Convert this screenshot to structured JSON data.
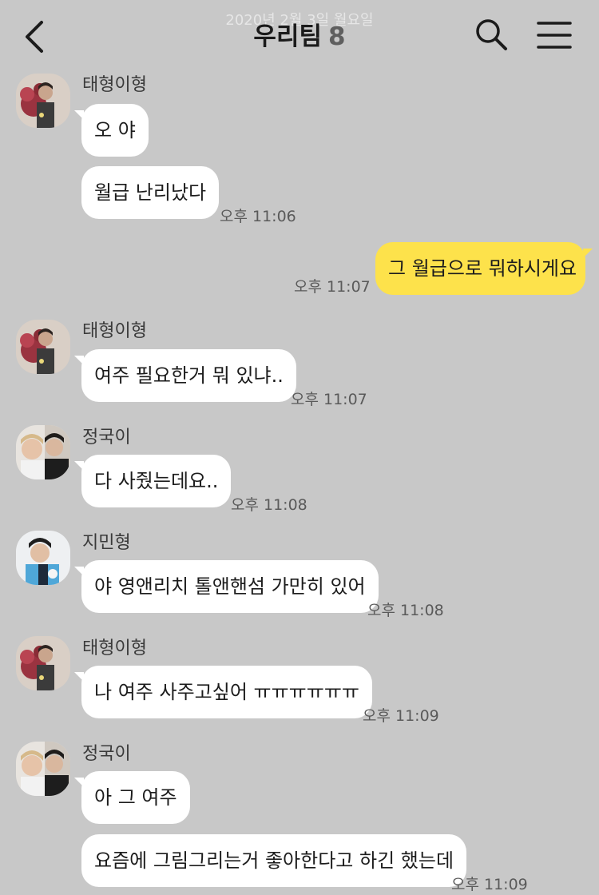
{
  "header": {
    "date_pill": "2020년 2월 3일 월요일",
    "title": "우리팀",
    "member_count": "8"
  },
  "messages": [
    {
      "sender": "태형이형",
      "text": "오 야"
    },
    {
      "text": "월급 난리났다",
      "time": "오후 11:06"
    },
    {
      "text": "그 월급으로 뭐하시게요",
      "time": "오후 11:07",
      "from_me": true
    },
    {
      "sender": "태형이형",
      "text": "여주 필요한거 뭐 있냐..",
      "time": "오후 11:07"
    },
    {
      "sender": "정국이",
      "text": "다 사줬는데요..",
      "time": "오후 11:08"
    },
    {
      "sender": "지민형",
      "text": "야 영앤리치 톨앤핸섬 가만히 있어",
      "time": "오후 11:08"
    },
    {
      "sender": "태형이형",
      "text": "나 여주 사주고싶어 ㅠㅠㅠㅠㅠㅠ",
      "time": "오후 11:09"
    },
    {
      "sender": "정국이",
      "text": "아 그 여주"
    },
    {
      "text": "요즘에 그림그리는거 좋아한다고 하긴 했는데",
      "time": "오후 11:09"
    }
  ],
  "colors": {
    "background": "#c8c8c8",
    "my_bubble": "#fde24b",
    "other_bubble": "#ffffff"
  },
  "icons": {
    "back": "chevron-left-icon",
    "search": "search-icon",
    "menu": "hamburger-menu-icon"
  }
}
